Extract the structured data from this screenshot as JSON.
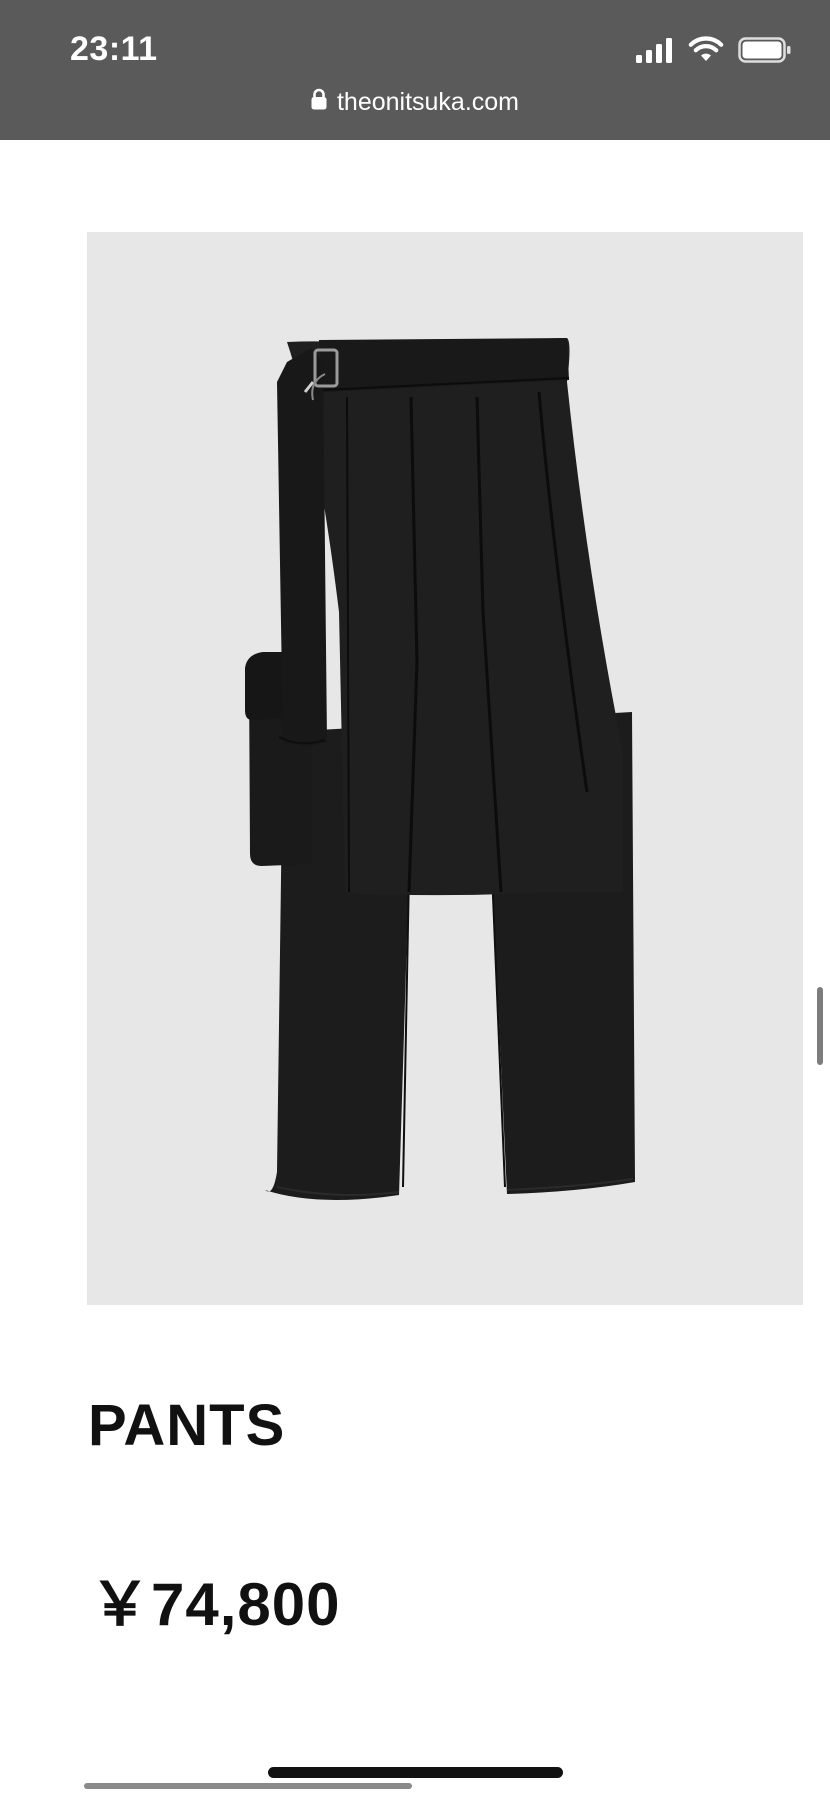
{
  "status_bar": {
    "time": "23:11",
    "signal_icon": "cellular-signal-icon",
    "wifi_icon": "wifi-icon",
    "battery_icon": "battery-icon"
  },
  "browser": {
    "lock_icon": "lock-icon",
    "url": "theonitsuka.com"
  },
  "product": {
    "image_icon": "pants-image",
    "title": "PANTS",
    "price": "￥74,800"
  },
  "colors": {
    "status_bar_bg": "#5a5a5a",
    "image_bg": "#e7e7e7",
    "text": "#111111"
  }
}
